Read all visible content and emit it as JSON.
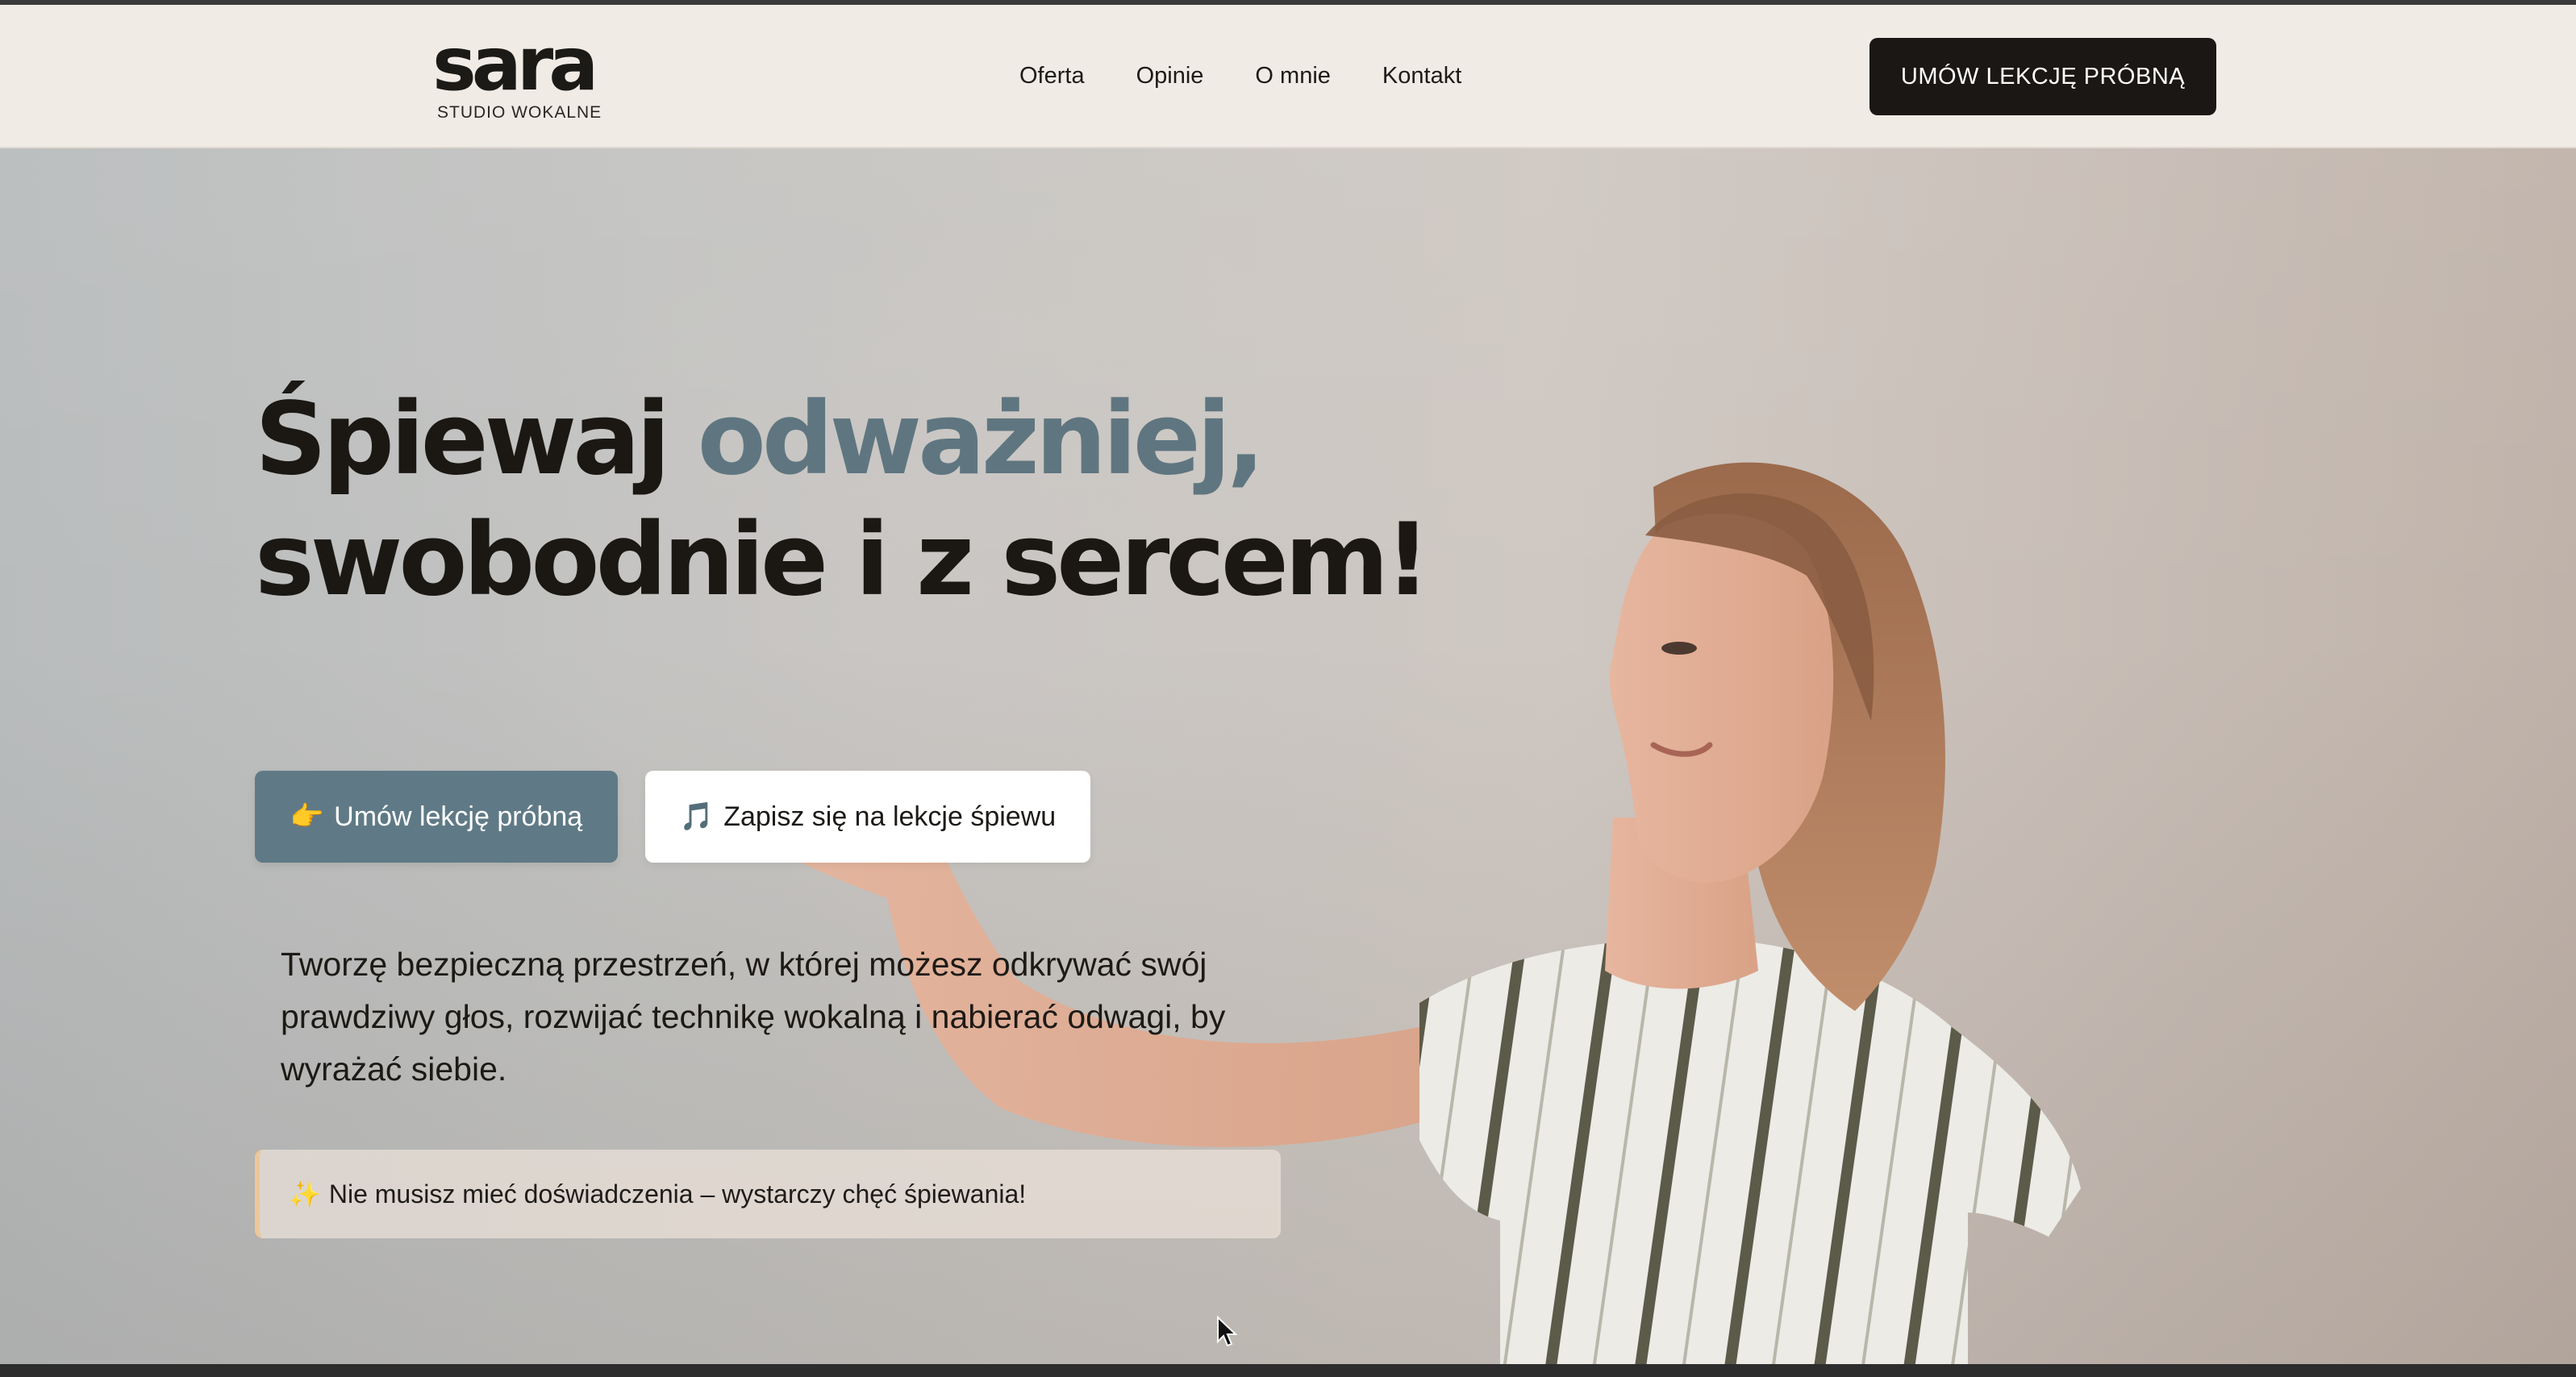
{
  "header": {
    "logo": {
      "word": "sara",
      "subtitle": "STUDIO WOKALNE"
    },
    "nav": [
      {
        "label": "Oferta"
      },
      {
        "label": "Opinie"
      },
      {
        "label": "O mnie"
      },
      {
        "label": "Kontakt"
      }
    ],
    "cta_label": "UMÓW LEKCJĘ PRÓBNĄ"
  },
  "hero": {
    "title_part1": "Śpiewaj ",
    "title_accent": "odważniej,",
    "title_line2": "swobodnie i z sercem!",
    "primary_button": {
      "icon": "👉",
      "label": "Umów lekcję próbną"
    },
    "secondary_button": {
      "icon": "🎵",
      "label": "Zapisz się na lekcje śpiewu"
    },
    "description": "Tworzę bezpieczną przestrzeń, w której możesz odkrywać swój prawdziwy głos, rozwijać technikę wokalną i nabierać odwagi, by wyrażać siebie.",
    "notice": {
      "icon": "✨",
      "text": "Nie musisz mieć doświadczenia – wystarczy chęć śpiewania!"
    }
  },
  "colors": {
    "accent": "#5f7680",
    "dark": "#1a1714",
    "header_bg": "#f1ebe5",
    "notice_border": "#efc69a"
  }
}
